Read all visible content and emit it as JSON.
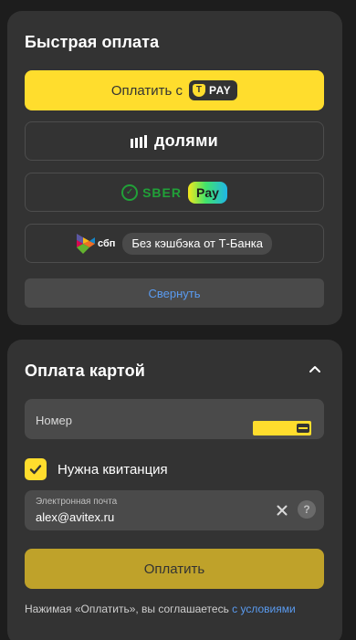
{
  "quick_pay": {
    "title": "Быстрая оплата",
    "tpay_button": {
      "label": "Оплатить с",
      "badge": "PAY"
    },
    "dolyami_button": {
      "label": "долями"
    },
    "sber_button": {
      "brand": "SBER",
      "pay": "Pay"
    },
    "sbp_button": {
      "brand": "сбп",
      "chip": "Без кэшбэка от Т-Банка"
    },
    "collapse_button": {
      "label": "Свернуть"
    }
  },
  "card_pay": {
    "title": "Оплата картой",
    "number_field": {
      "label": "Номер",
      "value": ""
    },
    "receipt_checkbox": {
      "label": "Нужна квитанция",
      "checked": true
    },
    "email_field": {
      "label": "Электронная почта",
      "value": "alex@avitex.ru"
    },
    "help_icon": "?",
    "pay_button": {
      "label": "Оплатить"
    },
    "terms": {
      "text": "Нажимая «Оплатить», вы соглашаетесь ",
      "link": "с условиями"
    }
  },
  "colors": {
    "background": "#1d1d1d",
    "card": "#333333",
    "accent_yellow": "#ffdd2d",
    "sber_green": "#21a038",
    "link_blue": "#5a9bf0"
  },
  "icons": [
    "tpay-logo-icon",
    "dolyami-logo-icon",
    "sber-logo-icon",
    "sbp-logo-icon",
    "chevron-up-icon",
    "card-icon",
    "check-icon",
    "close-icon",
    "help-icon"
  ]
}
